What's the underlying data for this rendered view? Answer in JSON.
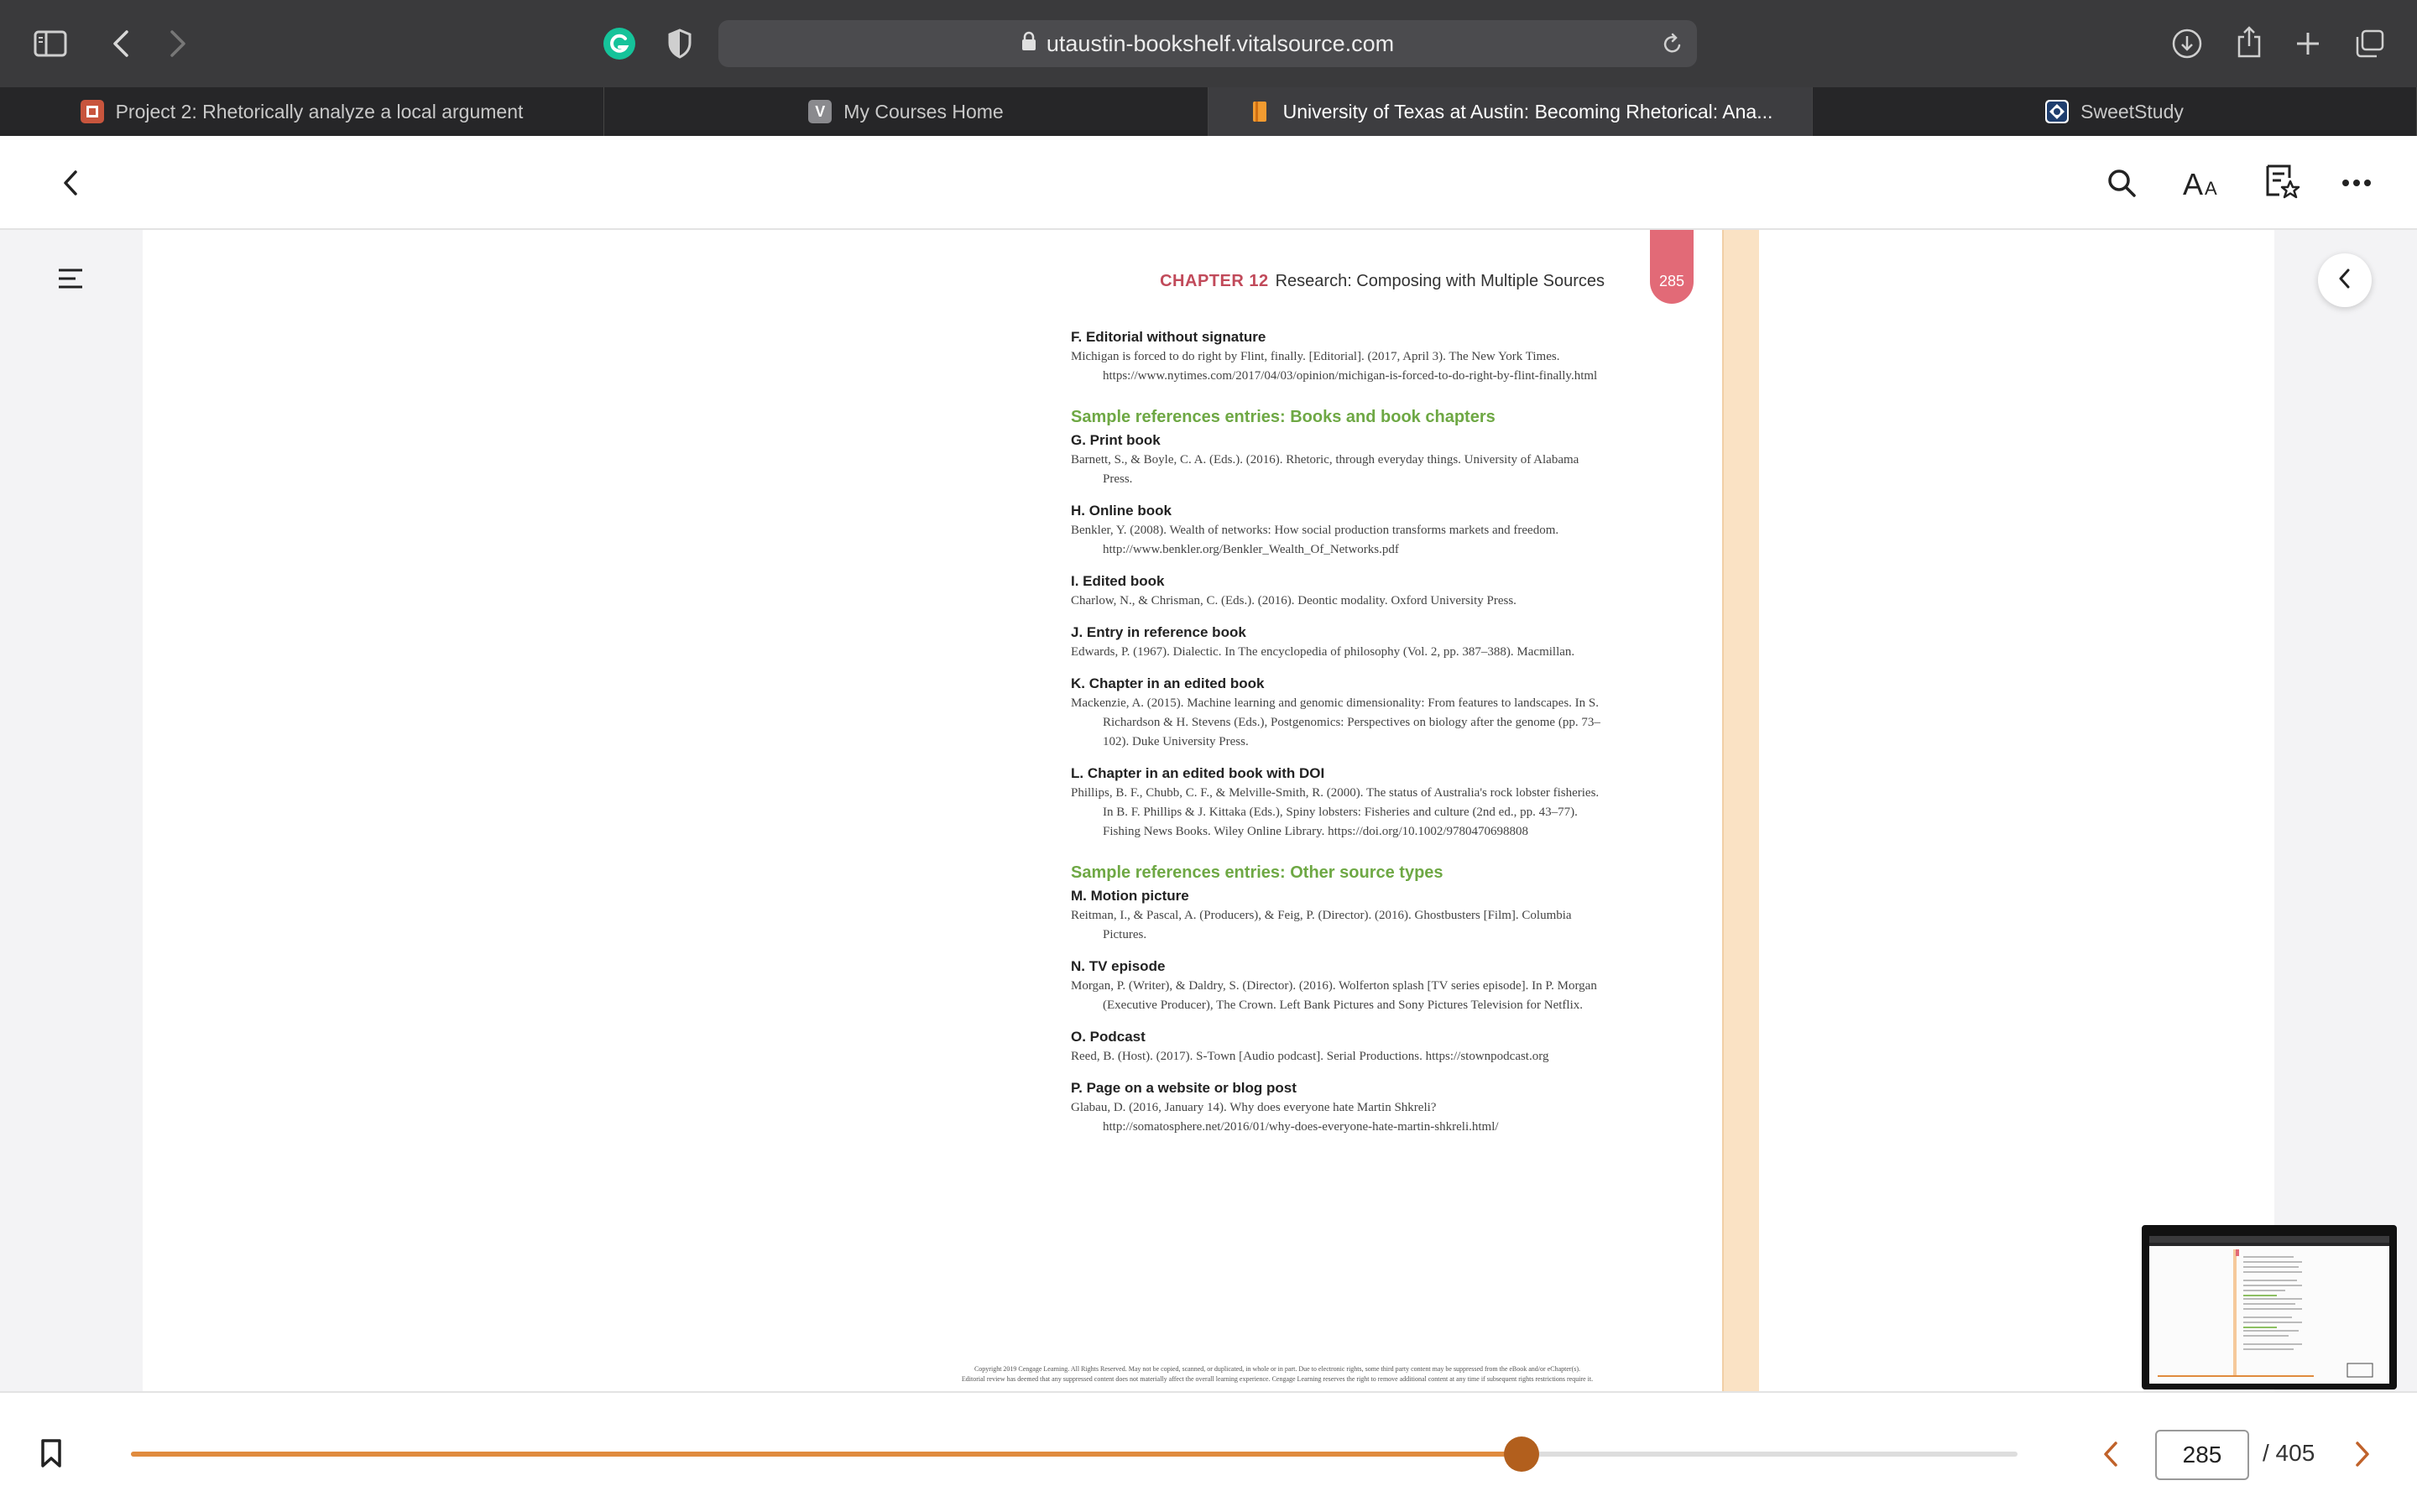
{
  "browser": {
    "url": "utaustin-bookshelf.vitalsource.com",
    "icons": {
      "sidebar": "sidebar-icon",
      "back": "chevron-left-icon",
      "forward": "chevron-right-icon",
      "grammarly": "grammarly-icon",
      "shield": "privacy-shield-icon",
      "lock": "lock-icon",
      "reload": "reload-icon",
      "download": "download-icon",
      "share": "share-icon",
      "new_tab": "plus-icon",
      "tab_overview": "tab-overview-icon"
    },
    "tabs": [
      {
        "title": "Project 2: Rhetorically analyze a local argument",
        "active": false
      },
      {
        "title": "My Courses Home",
        "favicon_letter": "V",
        "active": false
      },
      {
        "title": "University of Texas at Austin: Becoming Rhetorical: Ana...",
        "active": true
      },
      {
        "title": "SweetStudy",
        "active": false
      }
    ]
  },
  "reader": {
    "header_icons": [
      "back-icon",
      "search-icon",
      "text-size-icon",
      "bookmarks-list-icon",
      "more-icon"
    ],
    "chapter_label": "CHAPTER 12",
    "chapter_title": "Research: Composing with Multiple Sources",
    "page_tab": "285",
    "first_entry": {
      "title": "F. Editorial without signature",
      "ref": "Michigan is forced to do right by Flint, finally. [Editorial]. (2017, April 3). The New York Times. https://www.nytimes.com/2017/04/03/opinion/michigan-is-forced-to-do-right-by-flint-finally.html"
    },
    "section_books": "Sample references entries: Books and book chapters",
    "books": [
      {
        "title": "G. Print book",
        "ref": "Barnett, S., & Boyle, C. A. (Eds.). (2016). Rhetoric, through everyday things. University of Alabama Press."
      },
      {
        "title": "H. Online book",
        "ref": "Benkler, Y. (2008). Wealth of networks: How social production transforms markets and freedom. http://www.benkler.org/Benkler_Wealth_Of_Networks.pdf"
      },
      {
        "title": "I. Edited book",
        "ref": "Charlow, N., & Chrisman, C. (Eds.). (2016). Deontic modality. Oxford University Press."
      },
      {
        "title": "J. Entry in reference book",
        "ref": "Edwards, P. (1967). Dialectic. In The encyclopedia of philosophy (Vol. 2, pp. 387–388). Macmillan."
      },
      {
        "title": "K. Chapter in an edited book",
        "ref": "Mackenzie, A. (2015). Machine learning and genomic dimensionality: From features to landscapes. In S. Richardson & H. Stevens (Eds.), Postgenomics: Perspectives on biology after the genome (pp. 73–102). Duke University Press."
      },
      {
        "title": "L. Chapter in an edited book with DOI",
        "ref": "Phillips, B. F., Chubb, C. F., & Melville-Smith, R. (2000). The status of Australia's rock lobster fisheries. In B. F. Phillips & J. Kittaka (Eds.), Spiny lobsters: Fisheries and culture (2nd ed., pp. 43–77). Fishing News Books. Wiley Online Library. https://doi.org/10.1002/9780470698808"
      }
    ],
    "section_other": "Sample references entries: Other source types",
    "other": [
      {
        "title": "M. Motion picture",
        "ref": "Reitman, I., & Pascal, A. (Producers), & Feig, P. (Director). (2016). Ghostbusters [Film]. Columbia Pictures."
      },
      {
        "title": "N. TV episode",
        "ref": "Morgan, P. (Writer), & Daldry, S. (Director). (2016). Wolferton splash [TV series episode]. In P. Morgan (Executive Producer), The Crown. Left Bank Pictures and Sony Pictures Television for Netflix."
      },
      {
        "title": "O. Podcast",
        "ref": "Reed, B. (Host). (2017). S-Town [Audio podcast]. Serial Productions. https://stownpodcast.org"
      },
      {
        "title": "P. Page on a website or blog post",
        "ref": "Glabau, D. (2016, January 14). Why does everyone hate Martin Shkreli? http://somatosphere.net/2016/01/why-does-everyone-hate-martin-shkreli.html/"
      }
    ],
    "copyright_line1": "Copyright 2019 Cengage Learning. All Rights Reserved. May not be copied, scanned, or duplicated, in whole or in part. Due to electronic rights, some third party content may be suppressed from the eBook and/or eChapter(s).",
    "copyright_line2": "Editorial review has deemed that any suppressed content does not materially affect the overall learning experience. Cengage Learning reserves the right to remove additional content at any time if subsequent rights restrictions require it."
  },
  "footer": {
    "current_page": "285",
    "total_label": "/ 405",
    "progress_fraction": 0.737,
    "accent": "#e08b3e",
    "thumb_color": "#b25f1d"
  }
}
